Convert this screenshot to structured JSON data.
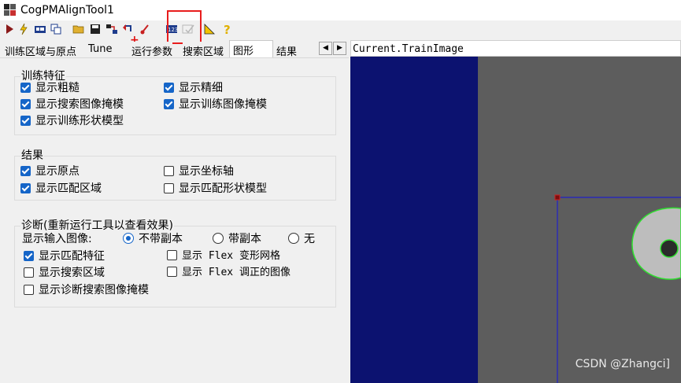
{
  "window": {
    "title": "CogPMAlignTool1"
  },
  "toolbar": {
    "buttons": [
      "run-icon",
      "electric-icon",
      "display-icon",
      "copy-icon",
      "open-icon",
      "save-icon",
      "link-icon",
      "import-icon",
      "train-icon",
      "image-123-icon",
      "disabled-check-icon",
      "measure-icon",
      "help-icon"
    ]
  },
  "tabs": {
    "items": [
      "训练区域与原点",
      "Tune",
      "运行参数",
      "搜索区域",
      "图形",
      "结果"
    ],
    "active": "图形"
  },
  "viewer": {
    "label": "Current.TrainImage",
    "watermark": "CSDN @Zhangci]"
  },
  "groups": {
    "train": {
      "title": "训练特征",
      "items": [
        {
          "label": "显示粗糙",
          "checked": true
        },
        {
          "label": "显示精细",
          "checked": true
        },
        {
          "label": "显示搜索图像掩模",
          "checked": true
        },
        {
          "label": "显示训练图像掩模",
          "checked": true
        },
        {
          "label": "显示训练形状模型",
          "checked": true
        }
      ]
    },
    "results": {
      "title": "结果",
      "items": [
        {
          "label": "显示原点",
          "checked": true
        },
        {
          "label": "显示坐标轴",
          "checked": false
        },
        {
          "label": "显示匹配区域",
          "checked": true
        },
        {
          "label": "显示匹配形状模型",
          "checked": false
        }
      ]
    },
    "diagnostics": {
      "title": "诊断(重新运行工具以查看效果)",
      "input_image_label": "显示输入图像:",
      "radios": [
        {
          "label": "不带副本",
          "selected": true
        },
        {
          "label": "带副本",
          "selected": false
        },
        {
          "label": "无",
          "selected": false
        }
      ],
      "items": [
        {
          "label": "显示匹配特征",
          "checked": true
        },
        {
          "label": "显示 Flex 变形网格",
          "checked": false
        },
        {
          "label": "显示搜索区域",
          "checked": false
        },
        {
          "label": "显示 Flex 调正的图像",
          "checked": false
        },
        {
          "label": "显示诊断搜索图像掩模",
          "checked": false
        }
      ]
    }
  }
}
